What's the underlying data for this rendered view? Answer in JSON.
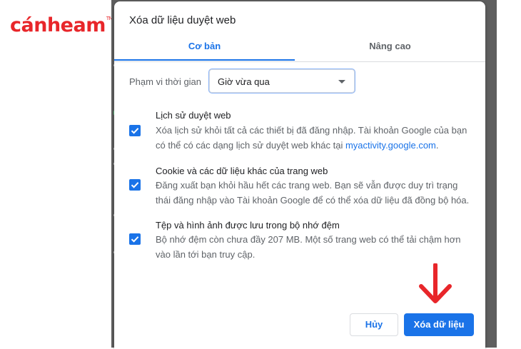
{
  "logo": {
    "text": "cánheam",
    "mark": "TM"
  },
  "dialog": {
    "title": "Xóa dữ liệu duyệt web",
    "tabs": [
      {
        "label": "Cơ bản",
        "active": true
      },
      {
        "label": "Nâng cao",
        "active": false
      }
    ],
    "time_range": {
      "label": "Phạm vi thời gian",
      "selected": "Giờ vừa qua"
    },
    "options": [
      {
        "title": "Lịch sử duyệt web",
        "checked": true,
        "desc_line1": "Xóa lịch sử khỏi tất cả các thiết bị đã đăng nhập. Tài khoản Google của bạn",
        "desc_line2_prefix": "có thể có các dạng lịch sử duyệt web khác tại ",
        "desc_link": "myactivity.google.com",
        "desc_line2_suffix": "."
      },
      {
        "title": "Cookie và các dữ liệu khác của trang web",
        "checked": true,
        "desc_line1": "Đăng xuất bạn khỏi hầu hết các trang web. Bạn sẽ vẫn được duy trì trạng",
        "desc_line2": "thái đăng nhập vào Tài khoản Google để có thể xóa dữ liệu đã đồng bộ hóa."
      },
      {
        "title": "Tệp và hình ảnh được lưu trong bộ nhớ đệm",
        "checked": true,
        "desc_line1": "Bộ nhớ đệm còn chưa đầy 207 MB. Một số trang web có thể tải chậm hơn",
        "desc_line2": "vào lần tới bạn truy cập."
      }
    ],
    "buttons": {
      "cancel": "Hủy",
      "clear": "Xóa dữ liệu"
    },
    "colors": {
      "accent": "#1a73e8",
      "annotation_arrow": "#e8262a"
    }
  }
}
